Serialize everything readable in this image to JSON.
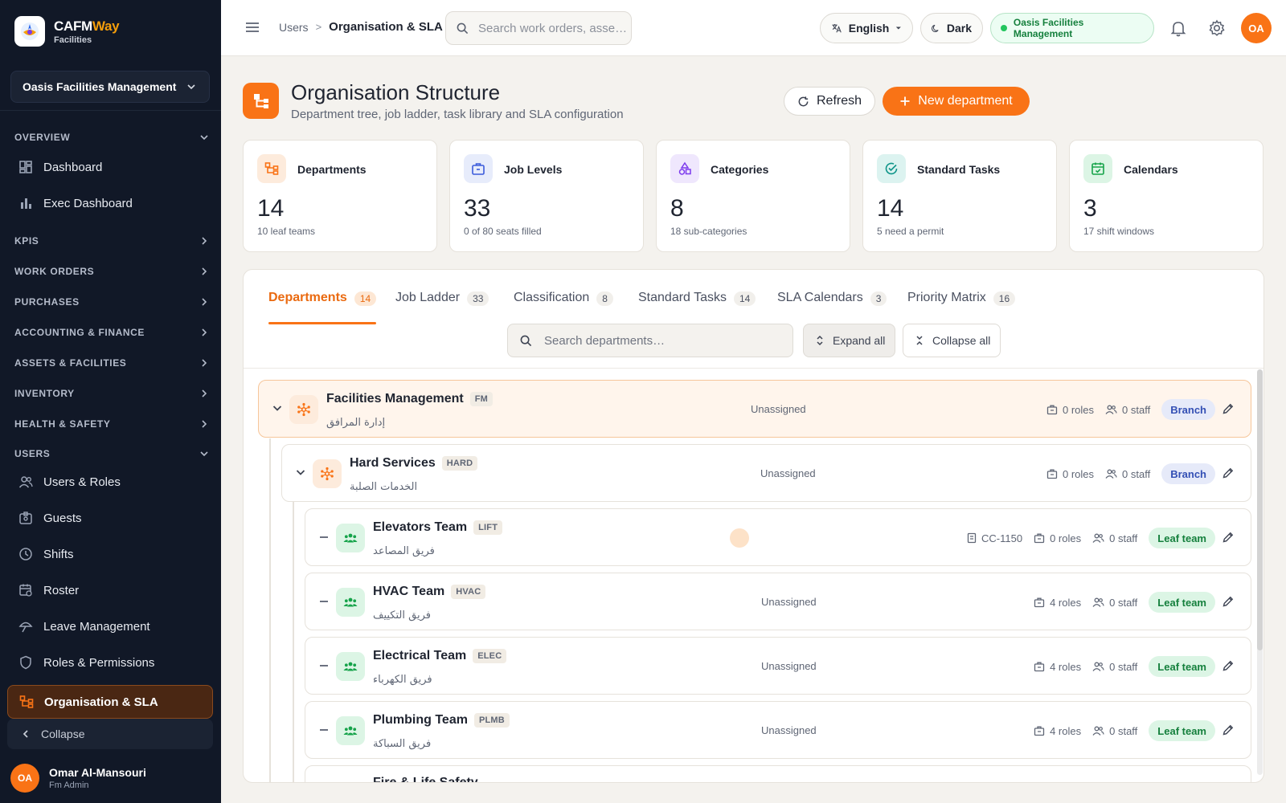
{
  "brand": {
    "name_main": "CAFM",
    "name_accent": "Way",
    "subtitle": "Facilities"
  },
  "org_selector": {
    "value": "Oasis Facilities Management"
  },
  "sidebar": {
    "sections": {
      "overview": "OVERVIEW",
      "kpis": "KPIS",
      "work_orders": "WORK ORDERS",
      "purchases": "PURCHASES",
      "accounting": "ACCOUNTING & FINANCE",
      "assets": "ASSETS & FACILITIES",
      "inventory": "INVENTORY",
      "health": "HEALTH & SAFETY",
      "users": "USERS"
    },
    "items": {
      "dashboard": "Dashboard",
      "exec_dashboard": "Exec Dashboard",
      "users_roles": "Users & Roles",
      "guests": "Guests",
      "shifts": "Shifts",
      "roster": "Roster",
      "leave": "Leave Management",
      "roles_permissions": "Roles & Permissions",
      "org_sla": "Organisation & SLA"
    },
    "collapse_label": "Collapse",
    "user": {
      "initials": "OA",
      "name": "Omar Al-Mansouri",
      "role": "Fm Admin"
    }
  },
  "topbar": {
    "breadcrumb_parent": "Users",
    "breadcrumb_sep": ">",
    "breadcrumb_current": "Organisation & SLA",
    "search_placeholder": "Search work orders, asse…",
    "language": "English",
    "theme": "Dark",
    "org_status": "Oasis Facilities Management",
    "avatar_initials": "OA"
  },
  "page": {
    "title": "Organisation Structure",
    "subtitle": "Department tree, job ladder, task library and SLA configuration",
    "refresh_label": "Refresh",
    "new_label": "New department"
  },
  "stats": [
    {
      "label": "Departments",
      "value": "14",
      "note": "10 leaf teams",
      "icon": "org-tree-icon",
      "color": "#f97316",
      "bg": "#fdebdc"
    },
    {
      "label": "Job Levels",
      "value": "33",
      "note": "0 of 80 seats filled",
      "icon": "briefcase-icon",
      "color": "#3b5bdb",
      "bg": "#e7ecfb"
    },
    {
      "label": "Categories",
      "value": "8",
      "note": "18 sub-categories",
      "icon": "shapes-icon",
      "color": "#7c3aed",
      "bg": "#efe7fd"
    },
    {
      "label": "Standard Tasks",
      "value": "14",
      "note": "5 need a permit",
      "icon": "check-circle-icon",
      "color": "#0d9488",
      "bg": "#dcf3f0"
    },
    {
      "label": "Calendars",
      "value": "3",
      "note": "17 shift windows",
      "icon": "calendar-check-icon",
      "color": "#16a34a",
      "bg": "#dcf5e5"
    }
  ],
  "tabs": [
    {
      "label": "Departments",
      "count": "14"
    },
    {
      "label": "Job Ladder",
      "count": "33"
    },
    {
      "label": "Classification",
      "count": "8"
    },
    {
      "label": "Standard Tasks",
      "count": "14"
    },
    {
      "label": "SLA Calendars",
      "count": "3"
    },
    {
      "label": "Priority Matrix",
      "count": "16"
    }
  ],
  "dept_toolbar": {
    "search_placeholder": "Search departments…",
    "expand_label": "Expand all",
    "collapse_label": "Collapse all"
  },
  "departments": [
    {
      "name": "Facilities Management",
      "code": "FM",
      "name_ar": "إدارة المرافق",
      "assigned": "Unassigned",
      "cost_center": "",
      "roles": "0 roles",
      "staff": "0 staff",
      "type": "Branch"
    },
    {
      "name": "Hard Services",
      "code": "HARD",
      "name_ar": "الخدمات الصلبة",
      "assigned": "Unassigned",
      "cost_center": "",
      "roles": "0 roles",
      "staff": "0 staff",
      "type": "Branch"
    },
    {
      "name": "Elevators Team",
      "code": "LIFT",
      "name_ar": "فريق المصاعد",
      "assigned": "",
      "cost_center": "CC-1150",
      "roles": "0 roles",
      "staff": "0 staff",
      "type": "Leaf team"
    },
    {
      "name": "HVAC Team",
      "code": "HVAC",
      "name_ar": "فريق التكييف",
      "assigned": "Unassigned",
      "cost_center": "",
      "roles": "4 roles",
      "staff": "0 staff",
      "type": "Leaf team"
    },
    {
      "name": "Electrical Team",
      "code": "ELEC",
      "name_ar": "فريق الكهرباء",
      "assigned": "Unassigned",
      "cost_center": "",
      "roles": "4 roles",
      "staff": "0 staff",
      "type": "Leaf team"
    },
    {
      "name": "Plumbing Team",
      "code": "PLMB",
      "name_ar": "فريق السباكة",
      "assigned": "Unassigned",
      "cost_center": "",
      "roles": "4 roles",
      "staff": "0 staff",
      "type": "Leaf team"
    },
    {
      "name": "Fire & Life Safety",
      "code": "",
      "name_ar": "",
      "assigned": "",
      "cost_center": "",
      "roles": "",
      "staff": "",
      "type": ""
    }
  ],
  "colors": {
    "accent": "#f97316",
    "sidebar_bg": "#111827",
    "page_bg": "#f4f2ee",
    "leaf_green": "#16a34a",
    "branch_blue": "#334fb4"
  }
}
